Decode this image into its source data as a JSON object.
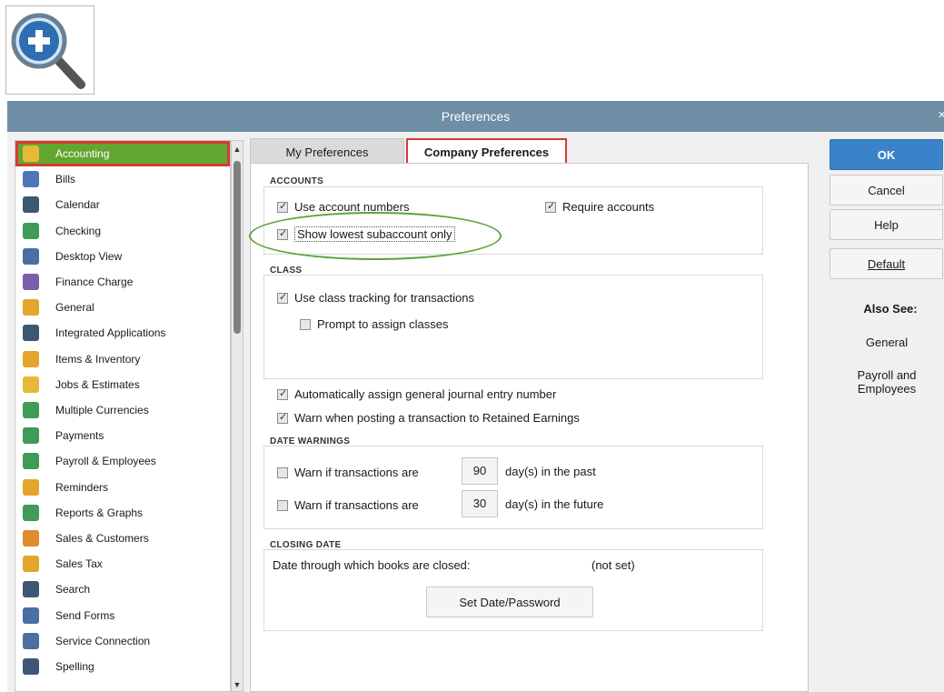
{
  "window": {
    "title": "Preferences",
    "close": "×"
  },
  "sidebar": {
    "items": [
      {
        "label": "Accounting",
        "icon": "pencil-ledger-icon",
        "color": "#e8b938"
      },
      {
        "label": "Bills",
        "icon": "bills-icon",
        "color": "#4f76b8"
      },
      {
        "label": "Calendar",
        "icon": "calendar-icon",
        "color": "#3d5873"
      },
      {
        "label": "Checking",
        "icon": "checking-icon",
        "color": "#3f9b55"
      },
      {
        "label": "Desktop View",
        "icon": "desktop-view-icon",
        "color": "#4a6fa5"
      },
      {
        "label": "Finance Charge",
        "icon": "finance-charge-icon",
        "color": "#7a5ea8"
      },
      {
        "label": "General",
        "icon": "general-icon",
        "color": "#e3a52b"
      },
      {
        "label": "Integrated Applications",
        "icon": "integrated-apps-icon",
        "color": "#3d5873"
      },
      {
        "label": "Items & Inventory",
        "icon": "items-inventory-icon",
        "color": "#e3a52b"
      },
      {
        "label": "Jobs & Estimates",
        "icon": "jobs-estimates-icon",
        "color": "#e8b938"
      },
      {
        "label": "Multiple Currencies",
        "icon": "currencies-icon",
        "color": "#3f9b55"
      },
      {
        "label": "Payments",
        "icon": "payments-icon",
        "color": "#3f9b55"
      },
      {
        "label": "Payroll & Employees",
        "icon": "payroll-icon",
        "color": "#3f9b55"
      },
      {
        "label": "Reminders",
        "icon": "reminders-icon",
        "color": "#e3a52b"
      },
      {
        "label": "Reports & Graphs",
        "icon": "reports-graphs-icon",
        "color": "#3f9b55"
      },
      {
        "label": "Sales & Customers",
        "icon": "sales-customers-icon",
        "color": "#e08a2b"
      },
      {
        "label": "Sales Tax",
        "icon": "sales-tax-icon",
        "color": "#e3a52b"
      },
      {
        "label": "Search",
        "icon": "search-icon",
        "color": "#3d5873"
      },
      {
        "label": "Send Forms",
        "icon": "send-forms-icon",
        "color": "#4a6fa5"
      },
      {
        "label": "Service Connection",
        "icon": "service-connection-icon",
        "color": "#4a6fa5"
      },
      {
        "label": "Spelling",
        "icon": "spelling-icon",
        "color": "#3d5873"
      }
    ]
  },
  "tabs": {
    "my": "My Preferences",
    "company": "Company Preferences"
  },
  "accounts": {
    "label": "ACCOUNTS",
    "use_account_numbers": "Use account numbers",
    "require_accounts": "Require accounts",
    "show_lowest": "Show lowest subaccount only"
  },
  "class": {
    "label": "CLASS",
    "use_class_tracking": "Use class tracking for transactions",
    "prompt_assign": "Prompt to assign classes"
  },
  "general": {
    "auto_journal": "Automatically assign general journal entry number",
    "warn_retained": "Warn when posting a transaction to Retained Earnings"
  },
  "date_warnings": {
    "label": "DATE WARNINGS",
    "warn_text": "Warn if transactions are",
    "past_value": "90",
    "past_suffix": "day(s) in the past",
    "future_value": "30",
    "future_suffix": "day(s) in the future"
  },
  "closing_date": {
    "label": "CLOSING DATE",
    "text": "Date through which books are closed:",
    "value": "(not set)",
    "button": "Set Date/Password"
  },
  "buttons": {
    "ok": "OK",
    "cancel": "Cancel",
    "help": "Help",
    "default": "Default"
  },
  "also_see": {
    "title": "Also See:",
    "links": [
      "General",
      "Payroll and Employees"
    ]
  },
  "colors": {
    "accent": "#62a52f",
    "highlight": "#d63a33",
    "ok_blue": "#3b83c8",
    "oval": "#5aa43a"
  }
}
